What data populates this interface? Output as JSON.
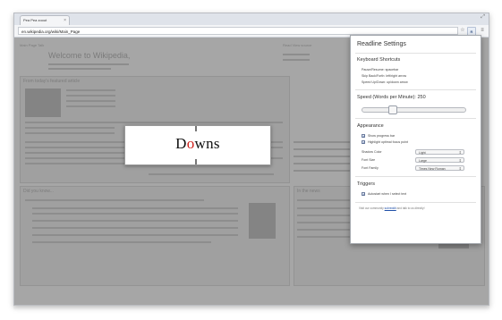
{
  "browser": {
    "tab_title": "Pea Pea zoout",
    "tab_close": "×",
    "url": "en.wikipedia.org/wiki/Main_Page",
    "corner_glyph": "⤢"
  },
  "reader": {
    "word_prefix": "D",
    "word_focus": "o",
    "word_suffix": "wns"
  },
  "panel": {
    "title": "Readline Settings",
    "shortcuts": {
      "heading": "Keyboard Shortcuts",
      "items": [
        "Pause/Resume: spacebar",
        "Skip Back/Forth: left/right arrow",
        "Speed Up/Down: up/down arrow"
      ]
    },
    "speed": {
      "label": "Speed (Words per Minute): 250",
      "value": 250,
      "fraction": 0.27
    },
    "appearance": {
      "heading": "Appearance",
      "checkboxes": [
        {
          "label": "Show progress bar",
          "checked": true
        },
        {
          "label": "Highlight optimal focus point",
          "checked": true
        }
      ],
      "selects": [
        {
          "label": "Shadow Color",
          "value": "Light"
        },
        {
          "label": "Font Size",
          "value": "Large"
        },
        {
          "label": "Font Family",
          "value": "Times New Roman"
        }
      ]
    },
    "triggers": {
      "heading": "Triggers",
      "checkboxes": [
        {
          "label": "Autostart when I select text",
          "checked": true
        }
      ]
    },
    "footer": {
      "prefix": "Visit our community ",
      "link": "subreddit",
      "suffix": " and talk to us directly!"
    }
  },
  "background_page": {
    "title": "Welcome to Wikipedia,",
    "featured_heading": "From today's featured article",
    "did_you_know": "Did you know...",
    "in_the_news": "In the news",
    "main_page_tab": "Main Page   Talk",
    "read_tab": "Read   View source"
  }
}
